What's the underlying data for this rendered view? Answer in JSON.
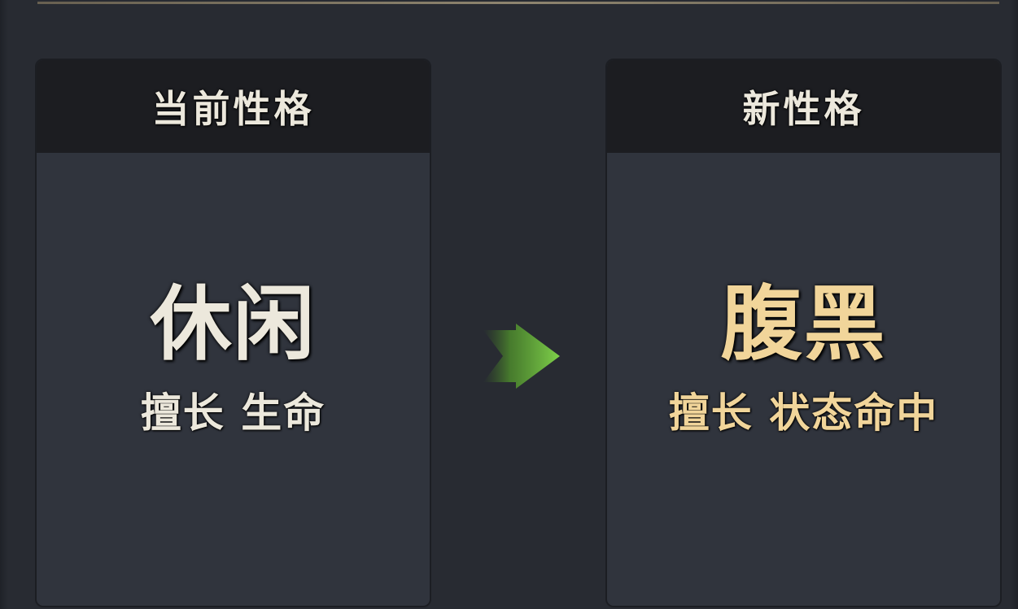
{
  "current_trait": {
    "header": "当前性格",
    "name": "休闲",
    "description": "擅长 生命"
  },
  "new_trait": {
    "header": "新性格",
    "name": "腹黑",
    "description": "擅长 状态命中"
  },
  "icons": {
    "transition": "arrow-right-icon"
  },
  "colors": {
    "background": "#282b32",
    "panel": "#30343d",
    "panel_header": "#1c1d21",
    "current_text": "#ece8dc",
    "new_text": "#f1d59a",
    "arrow": "#6ec23f"
  }
}
